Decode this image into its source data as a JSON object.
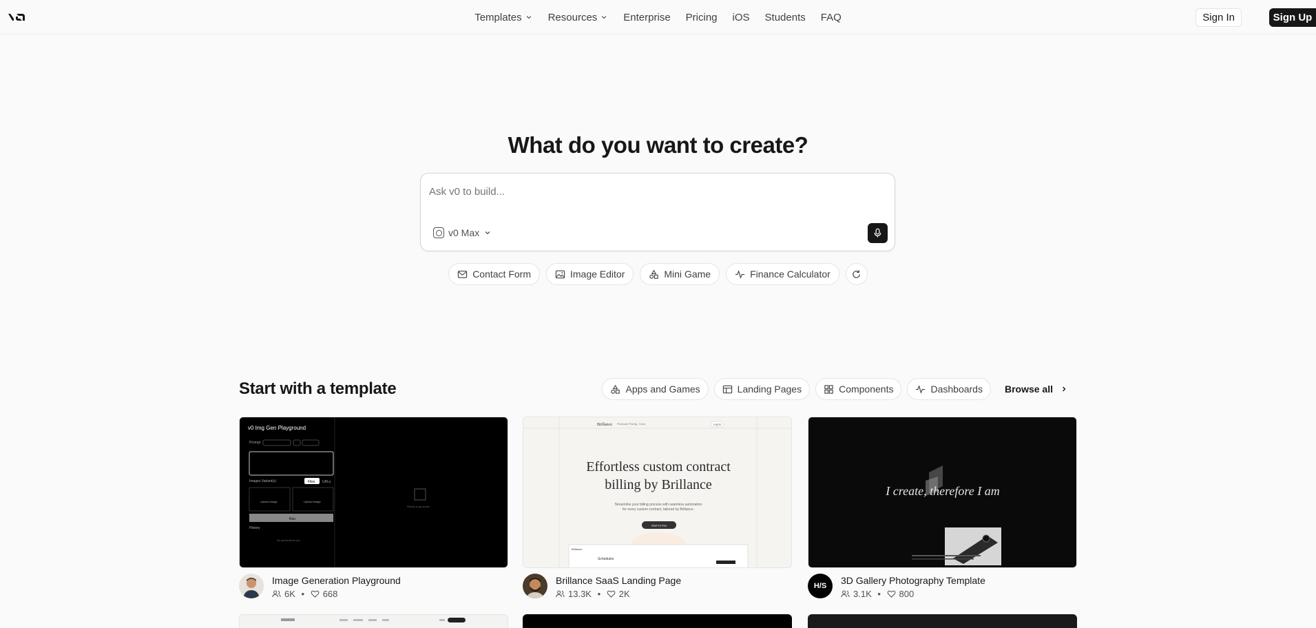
{
  "header": {
    "logo_text": "v0",
    "nav": [
      {
        "label": "Templates",
        "dropdown": true
      },
      {
        "label": "Resources",
        "dropdown": true
      },
      {
        "label": "Enterprise",
        "dropdown": false
      },
      {
        "label": "Pricing",
        "dropdown": false
      },
      {
        "label": "iOS",
        "dropdown": false
      },
      {
        "label": "Students",
        "dropdown": false
      },
      {
        "label": "FAQ",
        "dropdown": false
      }
    ],
    "sign_in": "Sign In",
    "sign_up": "Sign Up"
  },
  "hero": {
    "title": "What do you want to create?",
    "prompt_placeholder": "Ask v0 to build...",
    "model": "v0 Max",
    "suggestions": [
      "Contact Form",
      "Image Editor",
      "Mini Game",
      "Finance Calculator"
    ]
  },
  "templates": {
    "title": "Start with a template",
    "filters": [
      "Apps and Games",
      "Landing Pages",
      "Components",
      "Dashboards"
    ],
    "browse_all": "Browse all",
    "cards": [
      {
        "title": "Image Generation Playground",
        "users": "6K",
        "likes": "668",
        "thumb": {
          "app_title": "v0 Img Gen Playground",
          "prompt_label": "Prompt",
          "images_label": "Images Variant(s)",
          "files": "Files",
          "urls": "URLs",
          "upload": "Upload image",
          "run": "Run",
          "history": "History",
          "ready": "Ready to generate",
          "empty": "No generations yet"
        }
      },
      {
        "title": "Brillance SaaS Landing Page",
        "users": "13.3K",
        "likes": "2K",
        "thumb": {
          "brand": "Brillance",
          "nav": [
            "Products",
            "Pricing",
            "Docs"
          ],
          "login": "Log in",
          "headline_1": "Effortless custom contract",
          "headline_2": "billing by Brillance",
          "subtext_1": "Streamline your billing process with seamless automation",
          "subtext_2": "for every custom contract, tailored by Brillance.",
          "cta": "Start for free",
          "panel_title": "Schedules"
        }
      },
      {
        "title": "3D Gallery Photography Template",
        "users": "3.1K",
        "likes": "800",
        "avatar_text": "H/S",
        "thumb": {
          "headline": "I create, therefore I am"
        }
      }
    ]
  },
  "colors": {
    "background": "#fafafa",
    "primary": "#171717",
    "border": "#e5e5e5",
    "muted_text": "#737373"
  }
}
